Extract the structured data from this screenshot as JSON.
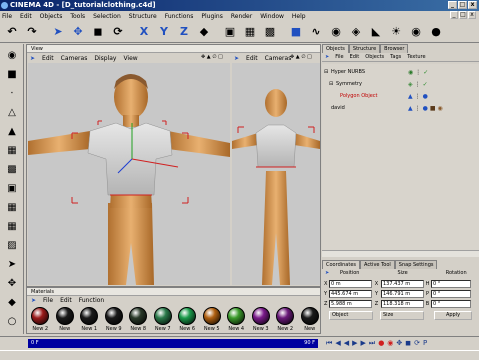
{
  "window": {
    "title": "CINEMA 4D - [D_tutorialclothing.c4d]",
    "controls": [
      "_",
      "□",
      "x"
    ]
  },
  "menubar": [
    "File",
    "Edit",
    "Objects",
    "Tools",
    "Selection",
    "Structure",
    "Functions",
    "Plugins",
    "Render",
    "Window",
    "Help"
  ],
  "toolbar": {
    "axis_x": "X",
    "axis_y": "Y",
    "axis_z": "Z"
  },
  "view_panel": {
    "title": "View",
    "left_menu": [
      "Edit",
      "Cameras",
      "Display",
      "View"
    ],
    "right_menu": [
      "Edit",
      "Cameras"
    ],
    "nav_icons": "✥ ▲ ∅ □"
  },
  "object_manager": {
    "tabs": [
      "Objects",
      "Structure",
      "Browser"
    ],
    "menu": [
      "File",
      "Edit",
      "Objects",
      "Tags",
      "Texture"
    ],
    "objects": [
      {
        "name": "Hyper NURBS",
        "indent": 0,
        "color": "#000000"
      },
      {
        "name": "Symmetry",
        "indent": 1,
        "color": "#000000"
      },
      {
        "name": "Polygon Object",
        "indent": 2,
        "color": "#c00000"
      },
      {
        "name": "david",
        "indent": 0,
        "color": "#000000"
      }
    ]
  },
  "coordinates": {
    "tabs": [
      "Coordinates",
      "Active Tool",
      "Snap Settings"
    ],
    "headers": [
      "Position",
      "Size",
      "Rotation"
    ],
    "rows": [
      {
        "axis": "X",
        "pos": "0 m",
        "size_axis": "X",
        "size": "137.437 m",
        "rot_axis": "H",
        "rot": "0 °"
      },
      {
        "axis": "Y",
        "pos": "445.674 m",
        "size_axis": "Y",
        "size": "146.791 m",
        "rot_axis": "P",
        "rot": "0 °"
      },
      {
        "axis": "Z",
        "pos": "5.988 m",
        "size_axis": "Z",
        "size": "118.318 m",
        "rot_axis": "B",
        "rot": "0 °"
      }
    ],
    "mode_left": "Object",
    "mode_right": "Size",
    "apply_label": "Apply"
  },
  "materials": {
    "title": "Materials",
    "menu": [
      "File",
      "Edit",
      "Function"
    ],
    "items": [
      {
        "label": "New 2",
        "color": "#9a1a1a"
      },
      {
        "label": "New",
        "color": "#1a1a1a"
      },
      {
        "label": "New 1",
        "color": "#1a1a1a"
      },
      {
        "label": "New 9",
        "color": "#1a1a1a"
      },
      {
        "label": "New 8",
        "color": "#2a3a2a"
      },
      {
        "label": "New 7",
        "color": "#2a7a4a"
      },
      {
        "label": "New 6",
        "color": "#1a9a4a"
      },
      {
        "label": "New 5",
        "color": "#b06010"
      },
      {
        "label": "New 4",
        "color": "#3a9a2a"
      },
      {
        "label": "New 3",
        "color": "#7a1a8a"
      },
      {
        "label": "New 2",
        "color": "#6a1a7a"
      },
      {
        "label": "New",
        "color": "#1a1a1a"
      }
    ]
  },
  "timeline": {
    "start": "0 F",
    "end": "90 F"
  }
}
